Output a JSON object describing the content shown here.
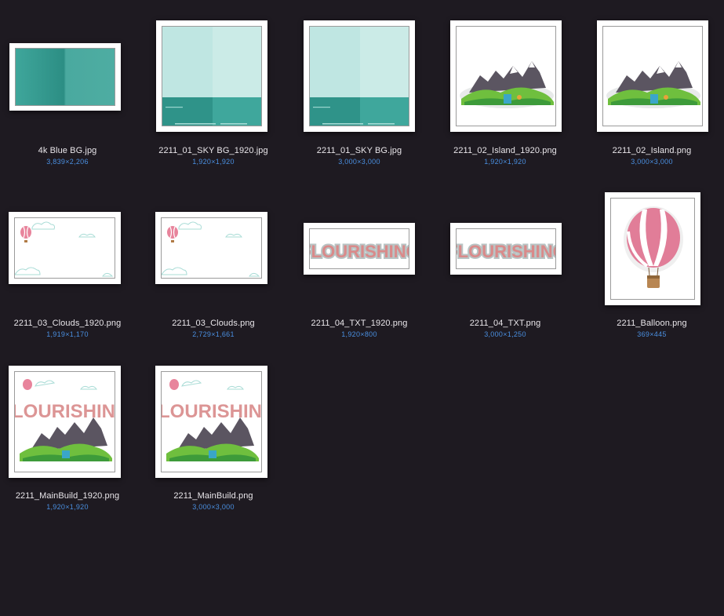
{
  "files": [
    {
      "name": "4k Blue BG.jpg",
      "dims": "3,839×2,206",
      "kind": "bluebg"
    },
    {
      "name": "2211_01_SKY BG_1920.jpg",
      "dims": "1,920×1,920",
      "kind": "sky"
    },
    {
      "name": "2211_01_SKY BG.jpg",
      "dims": "3,000×3,000",
      "kind": "sky"
    },
    {
      "name": "2211_02_Island_1920.png",
      "dims": "1,920×1,920",
      "kind": "island"
    },
    {
      "name": "2211_02_Island.png",
      "dims": "3,000×3,000",
      "kind": "island"
    },
    {
      "name": "2211_03_Clouds_1920.png",
      "dims": "1,919×1,170",
      "kind": "clouds"
    },
    {
      "name": "2211_03_Clouds.png",
      "dims": "2,729×1,661",
      "kind": "clouds"
    },
    {
      "name": "2211_04_TXT_1920.png",
      "dims": "1,920×800",
      "kind": "txt"
    },
    {
      "name": "2211_04_TXT.png",
      "dims": "3,000×1,250",
      "kind": "txt"
    },
    {
      "name": "2211_Balloon.png",
      "dims": "369×445",
      "kind": "balloon"
    },
    {
      "name": "2211_MainBuild_1920.png",
      "dims": "1,920×1,920",
      "kind": "main"
    },
    {
      "name": "2211_MainBuild.png",
      "dims": "3,000×3,000",
      "kind": "main"
    }
  ],
  "thumb_text": "FLOURISHING",
  "colors": {
    "background": "#1e1a21",
    "filename": "#e9e6ea",
    "dimensions": "#4a8fe0",
    "teal": "#3fa79c",
    "sky": "#c9ebe7"
  }
}
